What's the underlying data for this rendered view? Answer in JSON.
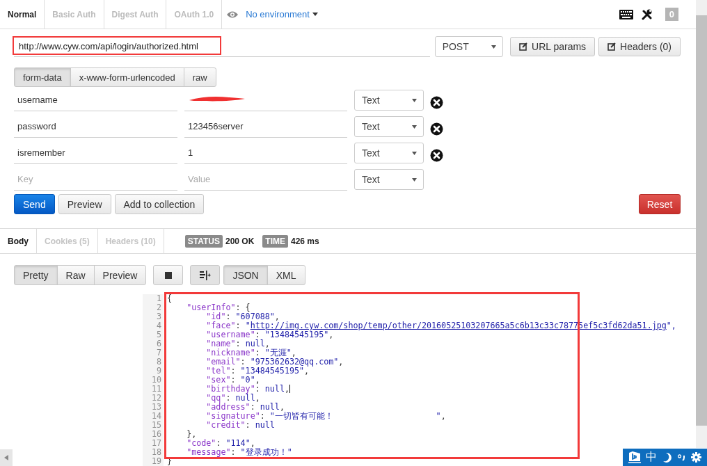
{
  "request_tabs": [
    {
      "label": "Normal",
      "selected": true
    },
    {
      "label": "Basic Auth",
      "selected": false
    },
    {
      "label": "Digest Auth",
      "selected": false
    },
    {
      "label": "OAuth 1.0",
      "selected": false
    }
  ],
  "environment": {
    "label": "No environment"
  },
  "counter": "0",
  "url": {
    "value": "http://www.cyw.com/api/login/authorized.html",
    "highlighted": true
  },
  "method": "POST",
  "url_buttons": [
    "URL params",
    "Headers (0)"
  ],
  "body_modes": [
    {
      "label": "form-data",
      "selected": true
    },
    {
      "label": "x-www-form-urlencoded",
      "selected": false
    },
    {
      "label": "raw",
      "selected": false
    }
  ],
  "params": [
    {
      "key": "username",
      "redacted": true,
      "type": "Text",
      "removable": true
    },
    {
      "key": "password",
      "value": "123456server",
      "type": "Text",
      "removable": true
    },
    {
      "key": "isremember",
      "value": "1",
      "type": "Text",
      "removable": true
    },
    {
      "key_placeholder": "Key",
      "value_placeholder": "Value",
      "type": "Text",
      "removable": false
    }
  ],
  "actions": [
    {
      "label": "Send",
      "kind": "primary"
    },
    {
      "label": "Preview",
      "kind": "default"
    },
    {
      "label": "Add to collection",
      "kind": "default"
    }
  ],
  "reset": "Reset",
  "response_tabs": [
    {
      "label": "Body",
      "selected": true
    },
    {
      "label": "Cookies (5)",
      "selected": false
    },
    {
      "label": "Headers (10)",
      "selected": false
    }
  ],
  "status": {
    "label": "STATUS",
    "value": "200 OK"
  },
  "time": {
    "label": "TIME",
    "value": "426 ms"
  },
  "view_modes": [
    {
      "label": "Pretty",
      "selected": true
    },
    {
      "label": "Raw",
      "selected": false
    },
    {
      "label": "Preview",
      "selected": false
    }
  ],
  "formats": [
    {
      "label": "JSON",
      "selected": true
    },
    {
      "label": "XML",
      "selected": false
    }
  ],
  "code": {
    "highlighted": true,
    "lines": [
      {
        "number": "1",
        "text": "{"
      },
      {
        "number": "2",
        "text": "    \"userInfo\": {"
      },
      {
        "number": "3",
        "text": "        \"id\": \"607088\","
      },
      {
        "number": "4",
        "text": "        \"face\": \"",
        "link": "http://img.cyw.com/shop/temp/other/20160525103207665a5c6b13c33c78775ef5c3fd62da51.jpg",
        "tail": "\","
      },
      {
        "number": "5",
        "text": "        \"username\": \"13484545195\","
      },
      {
        "number": "6",
        "text": "        \"name\": null,"
      },
      {
        "number": "7",
        "text": "        \"nickname\": \"无涯\","
      },
      {
        "number": "8",
        "text": "        \"email\": \"975362632@qq.com\","
      },
      {
        "number": "9",
        "text": "        \"tel\": \"13484545195\","
      },
      {
        "number": "10",
        "text": "        \"sex\": \"0\","
      },
      {
        "number": "11",
        "text": "        \"birthday\": null,",
        "cursor": true
      },
      {
        "number": "12",
        "text": "        \"qq\": null,"
      },
      {
        "number": "13",
        "text": "        \"address\": null,"
      },
      {
        "number": "14",
        "text": "        \"signature\": \"一切皆有可能！                     \","
      },
      {
        "number": "15",
        "text": "        \"credit\": null"
      },
      {
        "number": "16",
        "text": "    },"
      },
      {
        "number": "17",
        "text": "    \"code\": \"114\","
      },
      {
        "number": "18",
        "text": "    \"message\": \"登录成功！\""
      },
      {
        "number": "19",
        "text": "}"
      }
    ]
  },
  "ime": {
    "mode": "中"
  }
}
